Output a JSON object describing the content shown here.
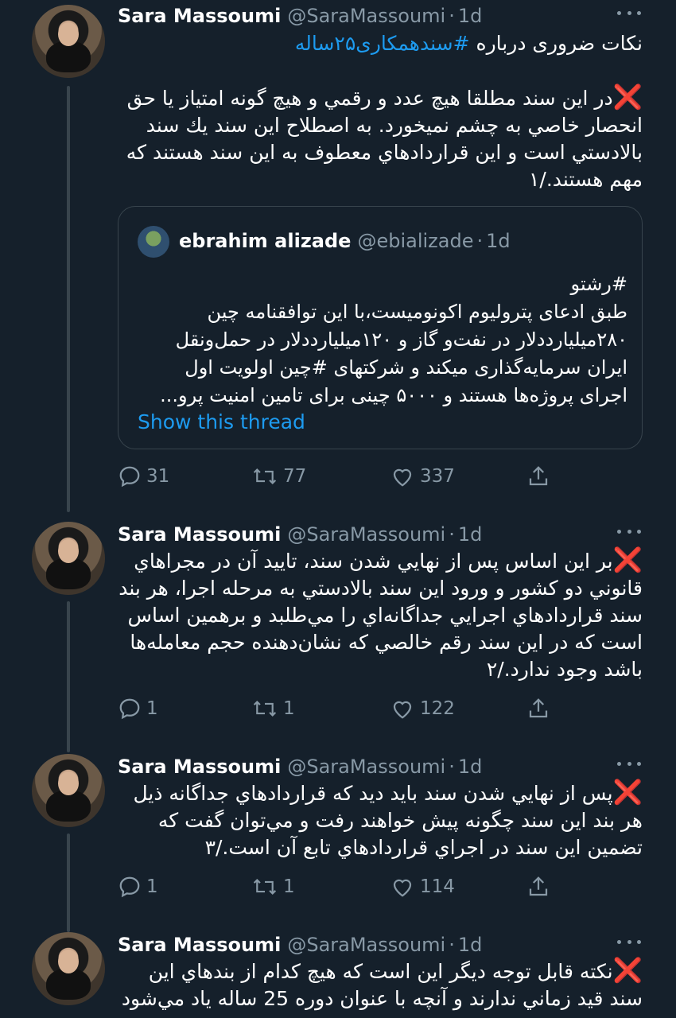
{
  "tweets": [
    {
      "author": "Sara Massoumi",
      "handle": "@SaraMassoumi",
      "separator": "·",
      "time": "1d",
      "text_lines": [
        {
          "text": "نکات ضروری درباره ",
          "hashtag": "#سندهمکاری۲۵ساله",
          "x": false
        },
        {
          "text": "",
          "hashtag": "",
          "x": false,
          "blank": true
        },
        {
          "text": "در اين سند مطلقا هيچ عدد و رقمي و هيچ گونه امتياز يا حق",
          "hashtag": "",
          "x": true
        },
        {
          "text": "انحصار خاصي به چشم نميخورد. به اصطلاح اين سند يك سند",
          "hashtag": "",
          "x": false
        },
        {
          "text": "بالادستي است و اين قراردادهاي معطوف به اين سند هستند كه",
          "hashtag": "",
          "x": false
        },
        {
          "text": "مهم هستند./۱",
          "hashtag": "",
          "x": false
        }
      ],
      "quote": {
        "author": "ebrahim alizade",
        "handle": "@ebializade",
        "separator": "·",
        "time": "1d",
        "lines": [
          "#رشتو",
          "طبق ادعای پترولیوم اکونومیست،با این توافقنامه چین",
          "۲۸۰میلیارددلار در نفت‌و گاز و ۱۲۰میلیارددلار در حمل‌ونقل",
          "ایران سرمایه‌گذاری میکند و شرکتهای #چین اولویت اول",
          "اجرای پروژه‌ها هستند و ۵۰۰۰ چینی برای تامین امنیت پرو..."
        ],
        "show_thread": "Show this thread"
      },
      "replies": "31",
      "retweets": "77",
      "likes": "337"
    },
    {
      "author": "Sara Massoumi",
      "handle": "@SaraMassoumi",
      "separator": "·",
      "time": "1d",
      "text_lines": [
        {
          "text": "بر اين اساس پس از نهايي شدن سند، تاييد آن در مجراهاي",
          "x": true
        },
        {
          "text": "قانوني دو كشور و ورود اين سند بالادستي به مرحله اجرا، هر بند",
          "x": false
        },
        {
          "text": "سند قراردادهاي اجرايي جداگانه‌اي را مي‌طلبد و برهمين اساس",
          "x": false
        },
        {
          "text": "است كه در اين سند رقم خالصي كه نشان‌دهنده حجم معامله‌ها",
          "x": false
        },
        {
          "text": "باشد وجود ندارد./۲",
          "x": false
        }
      ],
      "replies": "1",
      "retweets": "1",
      "likes": "122"
    },
    {
      "author": "Sara Massoumi",
      "handle": "@SaraMassoumi",
      "separator": "·",
      "time": "1d",
      "text_lines": [
        {
          "text": "پس از نهايي شدن سند بايد ديد كه قراردادهاي جداگانه ذيل",
          "x": true
        },
        {
          "text": "هر بند اين سند چگونه پيش خواهند رفت و مي‌توان گفت كه",
          "x": false
        },
        {
          "text": "تضمين اين سند در اجراي قراردادهاي تابع آن است./۳",
          "x": false
        }
      ],
      "replies": "1",
      "retweets": "1",
      "likes": "114"
    },
    {
      "author": "Sara Massoumi",
      "handle": "@SaraMassoumi",
      "separator": "·",
      "time": "1d",
      "text_lines": [
        {
          "text": "نكته قابل توجه ديگر اين است كه هيچ كدام از بندهاي اين",
          "x": true
        },
        {
          "text": "سند قيد زماني ندارند و آنچه با عنوان دوره 25 ساله ياد مي‌شود",
          "x": false
        }
      ]
    }
  ],
  "icons": {
    "x_mark": "❌",
    "reply": "reply-icon",
    "retweet": "retweet-icon",
    "like": "heart-icon",
    "share": "share-icon",
    "more": "more-icon"
  },
  "colors": {
    "background": "#15202b",
    "link": "#1d9bf0",
    "secondary": "#8899a6",
    "xmark": "#e0245e"
  }
}
